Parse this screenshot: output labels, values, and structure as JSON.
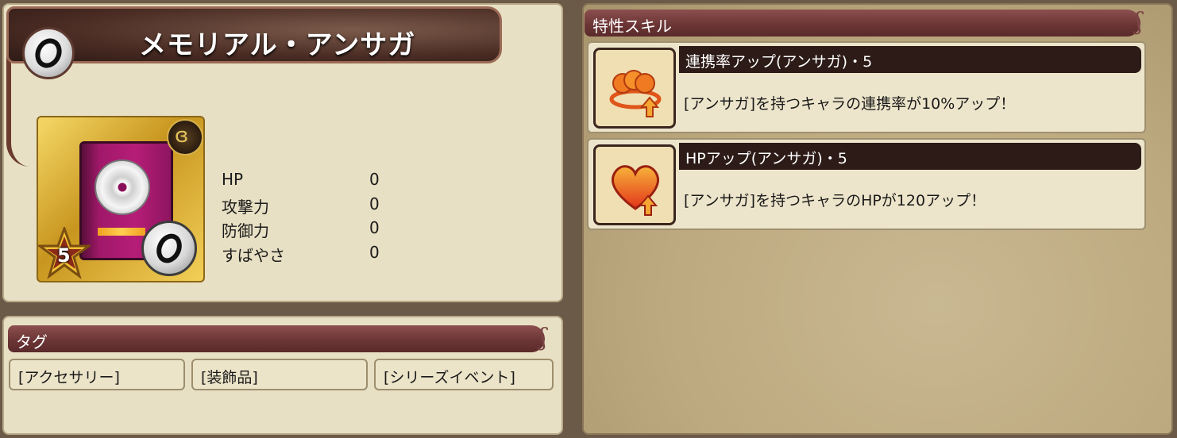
{
  "item": {
    "name": "メモリアル・アンサガ",
    "rarity": "5",
    "category_icon": "ring-icon"
  },
  "stats": [
    {
      "label": "HP",
      "value": "0"
    },
    {
      "label": "攻撃力",
      "value": "0"
    },
    {
      "label": "防御力",
      "value": "0"
    },
    {
      "label": "すばやさ",
      "value": "0"
    }
  ],
  "tags": {
    "header": "タグ",
    "items": [
      "[アクセサリー]",
      "[装飾品]",
      "[シリーズイベント]"
    ]
  },
  "skills": {
    "header": "特性スキル",
    "items": [
      {
        "name": "連携率アップ(アンサガ)・5",
        "description": "[アンサガ]を持つキャラの連携率が10%アップ！",
        "icon": "link-rate-icon"
      },
      {
        "name": "HPアップ(アンサガ)・5",
        "description": "[アンサガ]を持つキャラのHPが120アップ！",
        "icon": "heart-up-icon"
      }
    ]
  },
  "colors": {
    "panel_bg": "#e8e0c4",
    "header_bar": "#6a3434",
    "skill_name_bar": "#2c1b17",
    "right_bg": "#bda97f"
  }
}
